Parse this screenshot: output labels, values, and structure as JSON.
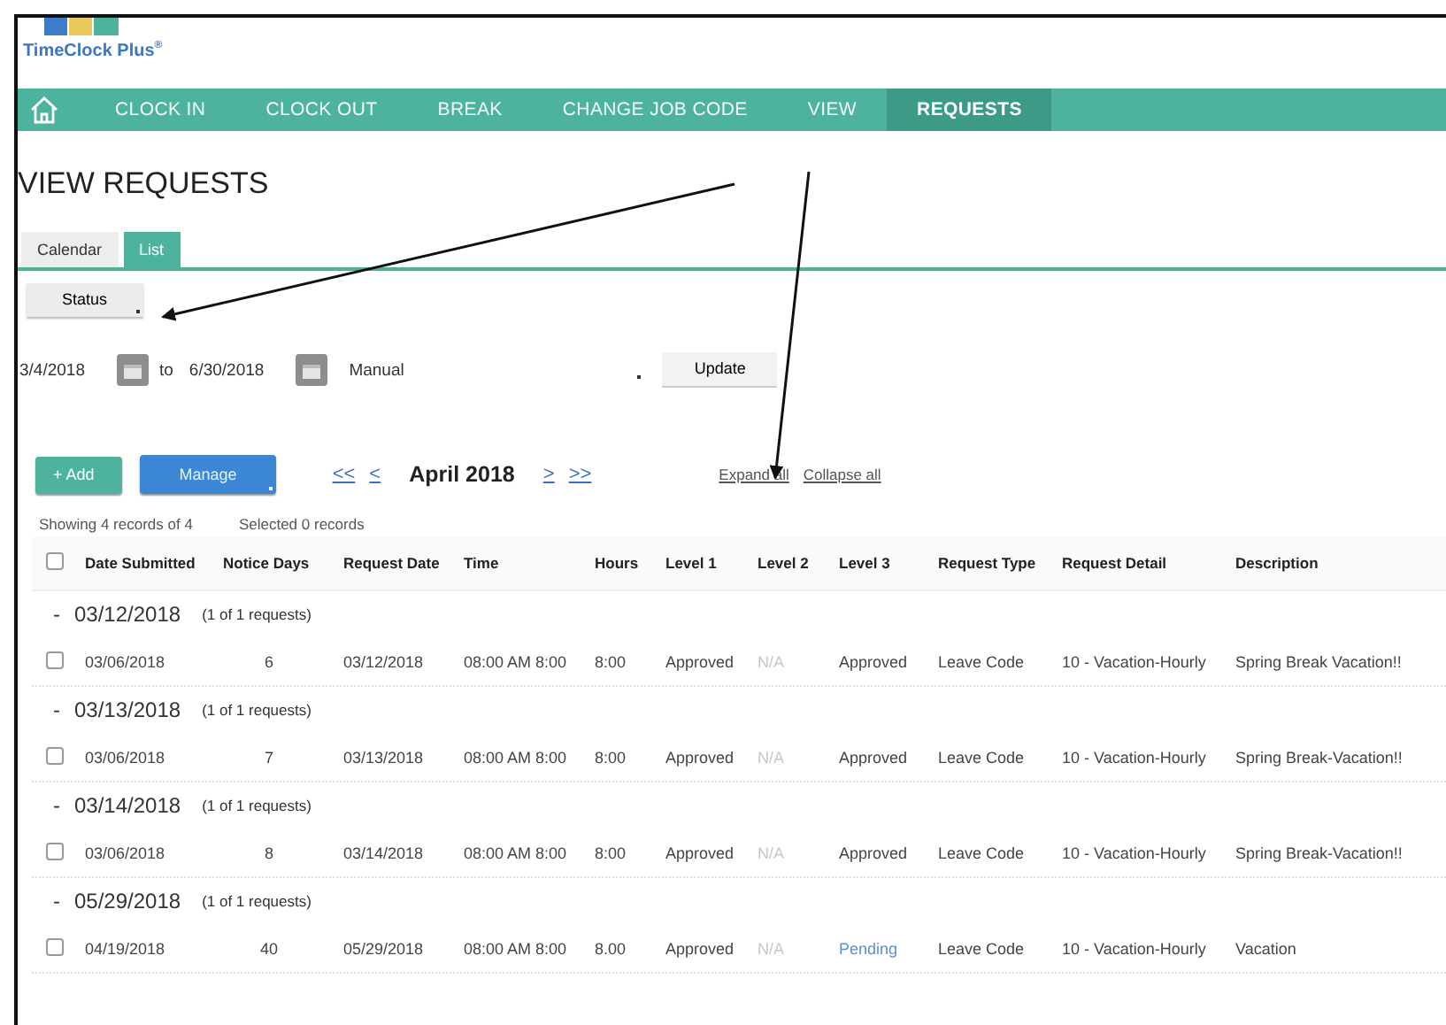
{
  "logo": {
    "text": "TimeClock Plus$^{®}$"
  },
  "nav": [
    {
      "label": "CLOCK IN",
      "selected": false
    },
    {
      "label": "CLOCK OUT",
      "selected": false
    },
    {
      "label": "BREAK",
      "selected": false
    },
    {
      "label": "CHANGE JOB CODE",
      "selected": false
    },
    {
      "label": "VIEW",
      "selected": false
    },
    {
      "label": "REQUESTS",
      "selected": true
    }
  ],
  "page_title": "VIEW REQUESTS",
  "tabs": [
    {
      "label": "Calendar",
      "selected": false
    },
    {
      "label": "List",
      "selected": true
    }
  ],
  "status_button": "Status",
  "date_range": {
    "from": "3/4/2018",
    "to_label": "to",
    "to": "6/30/2018",
    "mode": "Manual",
    "update_button": "Update"
  },
  "toolbar": {
    "add_button": "+ Add",
    "manage_button": "Manage",
    "first": "<<",
    "prev": "<",
    "month": "April 2018",
    "next": ">",
    "last": ">>",
    "expand_all": "Expand all",
    "collapse_all": "Collapse all"
  },
  "summary": {
    "showing": "Showing 4 records of 4",
    "selected": "Selected 0 records"
  },
  "table": {
    "select_all_checked": false,
    "columns": [
      "Date Submitted",
      "Notice Days",
      "Request Date",
      "Time",
      "Hours",
      "Level 1",
      "Level 2",
      "Level 3",
      "Request Type",
      "Request Detail",
      "Description"
    ],
    "groups": [
      {
        "toggle": "-",
        "date": "03/12/2018",
        "count": "(1 of 1 requests)",
        "rows": [
          {
            "checked": false,
            "cells": [
              "03/06/2018",
              "6",
              "03/12/2018",
              "08:00 AM 8:00",
              "8:00",
              {
                "text": "Approved",
                "color": "#444444"
              },
              {
                "text": "N/A",
                "color": "#c8c8c8"
              },
              {
                "text": "Approved",
                "color": "#444444"
              },
              "Leave Code",
              "10 - Vacation-Hourly",
              "Spring Break Vacation!!"
            ]
          }
        ]
      },
      {
        "toggle": "-",
        "date": "03/13/2018",
        "count": "(1 of 1 requests)",
        "rows": [
          {
            "checked": false,
            "cells": [
              "03/06/2018",
              "7",
              "03/13/2018",
              "08:00 AM 8:00",
              "8:00",
              {
                "text": "Approved",
                "color": "#444444"
              },
              {
                "text": "N/A",
                "color": "#c8c8c8"
              },
              {
                "text": "Approved",
                "color": "#444444"
              },
              "Leave Code",
              "10 - Vacation-Hourly",
              "Spring Break-Vacation!!"
            ]
          }
        ]
      },
      {
        "toggle": "-",
        "date": "03/14/2018",
        "count": "(1 of 1 requests)",
        "rows": [
          {
            "checked": false,
            "cells": [
              "03/06/2018",
              "8",
              "03/14/2018",
              "08:00 AM 8:00",
              "8:00",
              {
                "text": "Approved",
                "color": "#444444"
              },
              {
                "text": "N/A",
                "color": "#c8c8c8"
              },
              {
                "text": "Approved",
                "color": "#444444"
              },
              "Leave Code",
              "10 - Vacation-Hourly",
              "Spring Break-Vacation!!"
            ]
          }
        ]
      },
      {
        "toggle": "-",
        "date": "05/29/2018",
        "count": "(1 of 1 requests)",
        "rows": [
          {
            "checked": false,
            "cells": [
              "04/19/2018",
              "40",
              "05/29/2018",
              "08:00 AM 8:00",
              "8.00",
              {
                "text": "Approved",
                "color": "#444444"
              },
              {
                "text": "N/A",
                "color": "#c8c8c8"
              },
              {
                "text": "Pending",
                "color": "#5b8fd8"
              },
              "Leave Code",
              "10 - Vacation-Hourly",
              "Vacation"
            ]
          }
        ]
      }
    ]
  }
}
